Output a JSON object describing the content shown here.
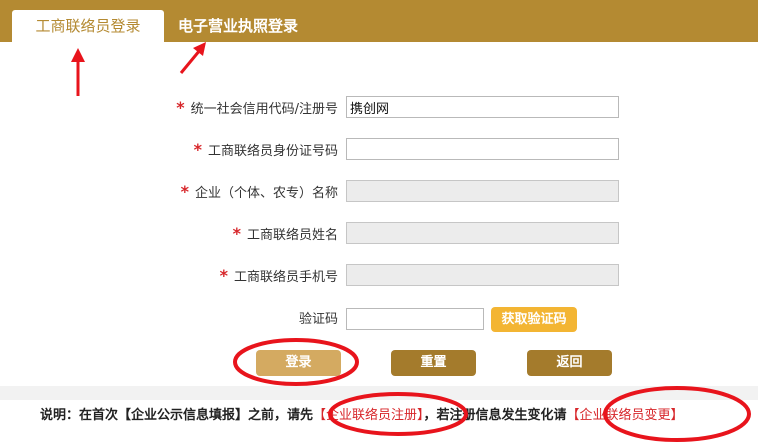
{
  "tabs": {
    "active": "工商联络员登录",
    "inactive": "电子营业执照登录"
  },
  "form": {
    "required_mark": "*",
    "credit_code": {
      "label": "统一社会信用代码/注册号",
      "value": "携创网"
    },
    "id_number": {
      "label": "工商联络员身份证号码",
      "value": ""
    },
    "company_name": {
      "label": "企业（个体、农专）名称",
      "value": ""
    },
    "liaison_name": {
      "label": "工商联络员姓名",
      "value": ""
    },
    "liaison_phone": {
      "label": "工商联络员手机号",
      "value": ""
    },
    "captcha": {
      "label": "验证码",
      "value": "",
      "get_code_label": "获取验证码"
    }
  },
  "buttons": {
    "login": "登录",
    "reset": "重置",
    "back": "返回"
  },
  "note": {
    "prefix": "说明：在首次【企业公示信息填报】之前，请先",
    "register_link": "【企业联络员注册】",
    "middle": "，若注册信息发生变化请",
    "change_link": "【企业联络员变更】"
  },
  "colors": {
    "brand": "#b48a32",
    "accent_orange": "#f3b533",
    "required_red": "#d7262a",
    "annotation_red": "#e8141c"
  }
}
